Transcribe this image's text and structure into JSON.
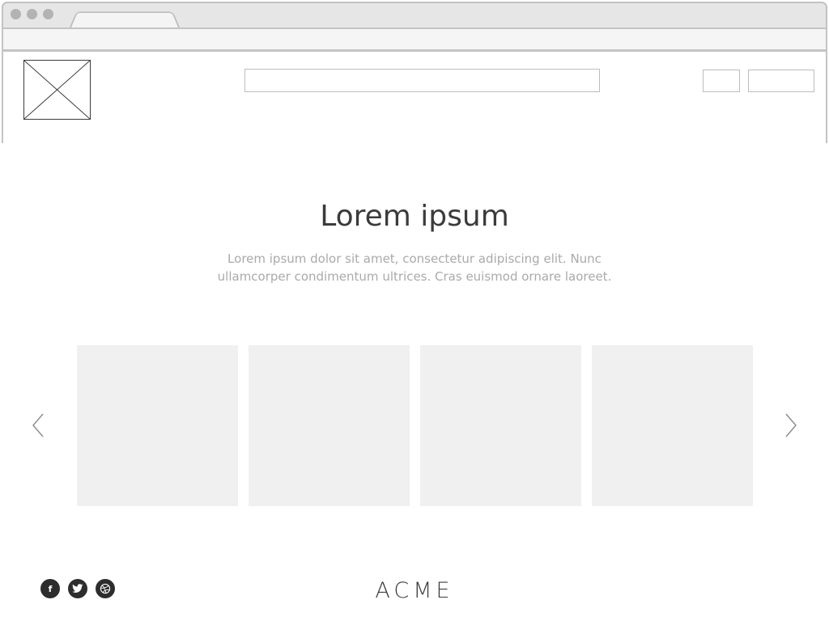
{
  "browser": {
    "window_controls": [
      "close-dot",
      "minimize-dot",
      "zoom-dot"
    ],
    "tab_title": "",
    "address_text": ""
  },
  "header": {
    "search": {
      "value": "",
      "placeholder": ""
    },
    "buttons": [
      "",
      ""
    ]
  },
  "hero": {
    "title": "Lorem ipsum",
    "text": "Lorem ipsum dolor sit amet, consectetur adipiscing elit. Nunc ullamcorper condimentum ultrices. Cras euismod ornare laoreet."
  },
  "carousel": {
    "items": [
      "",
      "",
      "",
      ""
    ],
    "prev_icon": "chevron-left-icon",
    "next_icon": "chevron-right-icon",
    "card_color": "#f0f0f0"
  },
  "footer": {
    "social": [
      {
        "name": "facebook",
        "glyph": "f"
      },
      {
        "name": "twitter",
        "glyph": "t"
      },
      {
        "name": "dribbble",
        "glyph": "◎"
      }
    ],
    "brand": "ACME"
  }
}
